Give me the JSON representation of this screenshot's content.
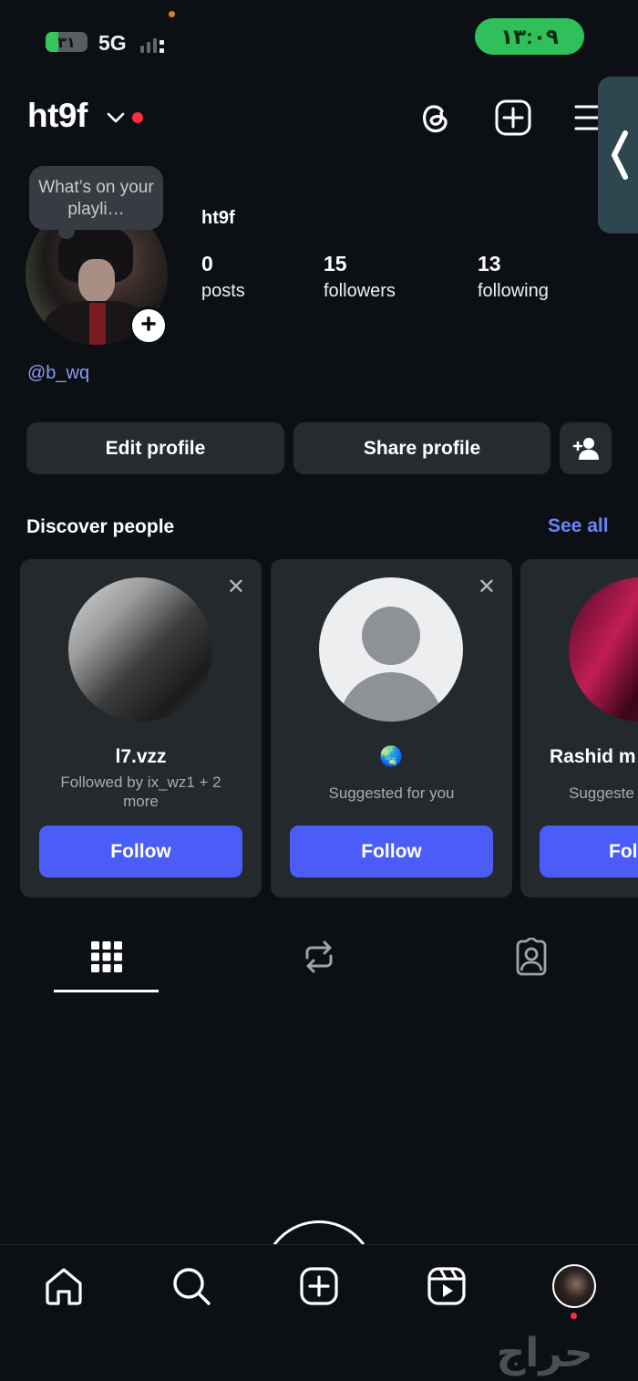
{
  "status_bar": {
    "battery": "٣١",
    "battery_level": 0.31,
    "network": "5G",
    "time": "١٣:٠٩"
  },
  "header": {
    "username": "ht9f",
    "icons": [
      "threads-icon",
      "create-icon",
      "menu-icon"
    ]
  },
  "profile": {
    "note": "What’s on your playli…",
    "full_name": "ht9f",
    "handle": "@b_wq",
    "stats": [
      {
        "count": "0",
        "label": "posts"
      },
      {
        "count": "15",
        "label": "followers"
      },
      {
        "count": "13",
        "label": "following"
      }
    ]
  },
  "actions": {
    "edit": "Edit profile",
    "share": "Share profile"
  },
  "discover": {
    "title": "Discover people",
    "see_all": "See all",
    "cards": [
      {
        "name": "l7.vzz",
        "subtitle": "Followed by ix_wz1 + 2 more",
        "button": "Follow"
      },
      {
        "name": "🌏",
        "subtitle": "Suggested for you",
        "button": "Follow"
      },
      {
        "name": "Rashid m",
        "subtitle": "Suggeste",
        "button": "Fol"
      }
    ]
  },
  "tabs": [
    "grid-icon",
    "reposts-icon",
    "tagged-icon"
  ],
  "nav": [
    "home-icon",
    "search-icon",
    "create-icon",
    "reels-icon",
    "profile-avatar"
  ],
  "watermark": "حراج",
  "colors": {
    "background": "#0c1014",
    "accent": "#4a5df9",
    "link": "#8c9cf5",
    "notification": "#ff2d3d"
  }
}
